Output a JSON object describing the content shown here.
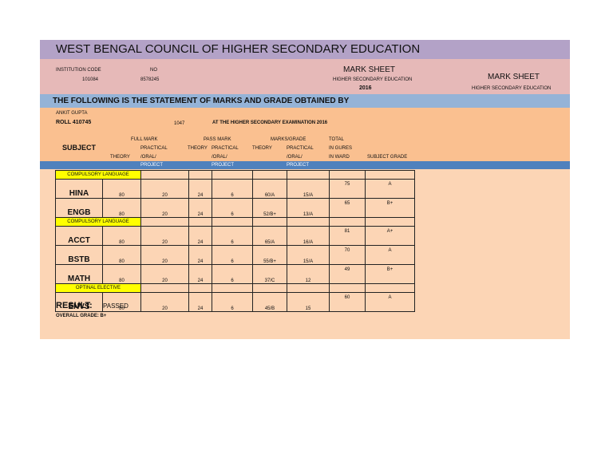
{
  "title": "WEST BENGAL COUNCIL OF HIGHER SECONDARY EDUCATION",
  "institution_code_label": "INSTITUTION CODE",
  "institution_code": "101084",
  "no_label": "NO",
  "no_value": "8578245",
  "marksheet_title": "MARK SHEET",
  "marksheet_sub": "HIGHER SECONDARY EDUCATION",
  "year": "2016",
  "marksheet_title_right": "MARK SHEET",
  "marksheet_sub_right": "HIGHER SECONDARY EDUCATION",
  "statement": "THE FOLLOWING IS THE STATEMENT OF MARKS AND GRADE OBTAINED BY",
  "student_name": "ANKIT GUPTA",
  "roll": "ROLL 410745",
  "code": "1047",
  "exam": "AT THE HIGHER SECONDARY EXAMINATION 2016",
  "headers": {
    "subject": "SUBJECT",
    "full_mark": "FULL MARK",
    "pass_mark": "PASS MARK",
    "marks_grade": "MARKS/GRADE",
    "theory": "THEORY",
    "practical": "PRACTICAL",
    "oral": "/ORAL/",
    "project": "PROJECT",
    "total": "TOTAL",
    "in_figures": "IN GURES",
    "in_ward": "IN WARD",
    "subject_grade": "SUBJECT GRADE"
  },
  "rows": [
    {
      "section": "COMPULSORY LANGUAGE"
    },
    {
      "subject": "HINA",
      "fm_th": "80",
      "fm_pr": "20",
      "pm_th": "24",
      "pm_pr": "6",
      "mg_th": "60/A",
      "mg_pr": "15/A",
      "total": "75",
      "grade": "A"
    },
    {
      "subject": "ENGB",
      "fm_th": "80",
      "fm_pr": "20",
      "pm_th": "24",
      "pm_pr": "6",
      "mg_th": "52/B+",
      "mg_pr": "13/A",
      "total": "65",
      "grade": "B+"
    },
    {
      "section": "COMPULSORY LANGUAGE"
    },
    {
      "subject": "ACCT",
      "fm_th": "80",
      "fm_pr": "20",
      "pm_th": "24",
      "pm_pr": "6",
      "mg_th": "65/A",
      "mg_pr": "16/A",
      "total": "81",
      "grade": "A+"
    },
    {
      "subject": "BSTB",
      "fm_th": "80",
      "fm_pr": "20",
      "pm_th": "24",
      "pm_pr": "6",
      "mg_th": "55/B+",
      "mg_pr": "15/A",
      "total": "70",
      "grade": "A"
    },
    {
      "subject": "MATH",
      "fm_th": "80",
      "fm_pr": "20",
      "pm_th": "24",
      "pm_pr": "6",
      "mg_th": "37/C",
      "mg_pr": "12",
      "total": "49",
      "grade": "B+"
    },
    {
      "section": "OPTINAL ELECTIVE"
    },
    {
      "subject": "ENVS",
      "fm_th": "80",
      "fm_pr": "20",
      "pm_th": "24",
      "pm_pr": "6",
      "mg_th": "45/B",
      "mg_pr": "15",
      "total": "60",
      "grade": "A"
    }
  ],
  "result_label": "RESULT:",
  "result": "PASSED",
  "overall_grade": "OVERALL GRADE: B+"
}
